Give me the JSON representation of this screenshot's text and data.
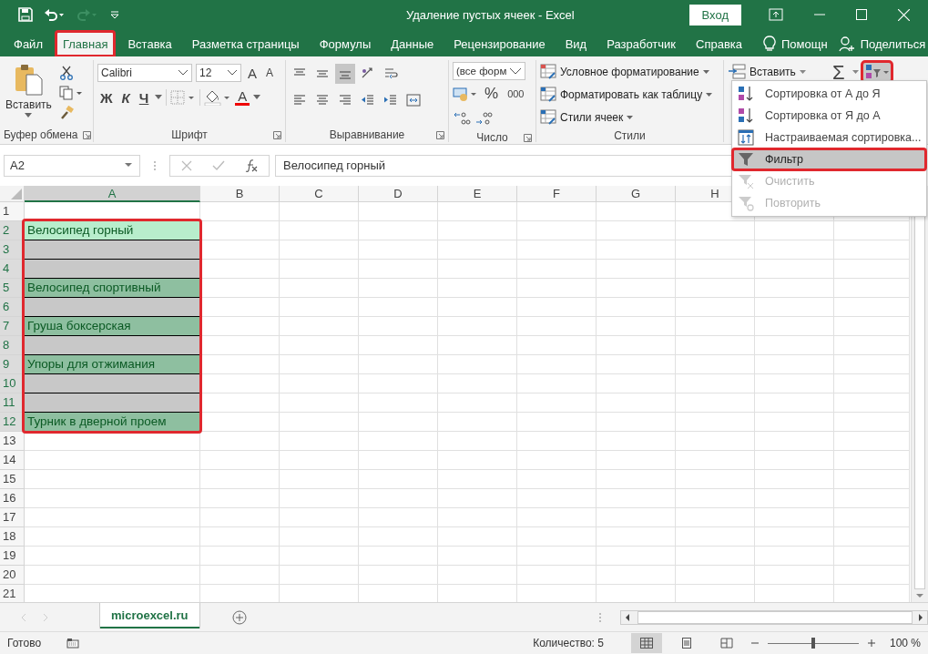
{
  "window": {
    "title": "Удаление пустых ячеек - Excel",
    "sign_in": "Вход"
  },
  "tabs": [
    {
      "label": "Файл",
      "selected": false
    },
    {
      "label": "Главная",
      "selected": true
    },
    {
      "label": "Вставка",
      "selected": false
    },
    {
      "label": "Разметка страницы",
      "selected": false
    },
    {
      "label": "Формулы",
      "selected": false
    },
    {
      "label": "Данные",
      "selected": false
    },
    {
      "label": "Рецензирование",
      "selected": false
    },
    {
      "label": "Вид",
      "selected": false
    },
    {
      "label": "Разработчик",
      "selected": false
    },
    {
      "label": "Справка",
      "selected": false
    }
  ],
  "tell_me": "Помощн",
  "share": "Поделиться",
  "ribbon": {
    "clipboard": {
      "paste": "Вставить",
      "label": "Буфер обмена"
    },
    "font": {
      "name": "Calibri",
      "size": "12",
      "grow": "A",
      "shrink": "A",
      "styles": [
        "Ж",
        "К",
        "Ч"
      ],
      "color_letter": "A",
      "label": "Шрифт"
    },
    "alignment": {
      "rows": [
        [
          {
            "kind": "top",
            "on": false
          },
          {
            "kind": "middle",
            "on": false
          },
          {
            "kind": "bottom",
            "on": true
          },
          {
            "kind": "orientation",
            "on": false
          },
          {
            "kind": "wrap",
            "on": false
          }
        ],
        [
          {
            "kind": "left",
            "on": false
          },
          {
            "kind": "center",
            "on": false
          },
          {
            "kind": "right",
            "on": false
          },
          {
            "kind": "outdent",
            "on": false
          },
          {
            "kind": "indent",
            "on": false
          },
          {
            "kind": "merge",
            "on": false
          }
        ]
      ],
      "label": "Выравнивание"
    },
    "number": {
      "format": "(все форм",
      "percent": "%",
      "thousands": "000",
      "label": "Число"
    },
    "styles": {
      "items": [
        "Условное форматирование",
        "Форматировать как таблицу",
        "Стили ячеек"
      ],
      "label": "Стили"
    },
    "cells": {
      "insert": "Вставить"
    },
    "editing": {
      "sum": "Σ",
      "sort_filter_highlighted": true
    }
  },
  "sort_menu": [
    {
      "kind": "sort_az",
      "label": "Сортировка от А до Я",
      "disabled": false,
      "selected": false
    },
    {
      "kind": "sort_za",
      "label": "Сортировка от Я до А",
      "disabled": false,
      "selected": false
    },
    {
      "kind": "custom",
      "label": "Настраиваемая сортировка...",
      "disabled": false,
      "selected": false
    },
    {
      "kind": "filter",
      "label": "Фильтр",
      "disabled": false,
      "selected": true
    },
    {
      "kind": "clear",
      "label": "Очистить",
      "disabled": true,
      "selected": false
    },
    {
      "kind": "reapply",
      "label": "Повторить",
      "disabled": true,
      "selected": false
    }
  ],
  "formula_bar": {
    "name_box": "A2",
    "formula": "Велосипед горный"
  },
  "columns": [
    {
      "label": "A",
      "selected": true
    },
    {
      "label": "B",
      "selected": false
    },
    {
      "label": "C",
      "selected": false
    },
    {
      "label": "D",
      "selected": false
    },
    {
      "label": "E",
      "selected": false
    },
    {
      "label": "F",
      "selected": false
    },
    {
      "label": "G",
      "selected": false
    },
    {
      "label": "H",
      "selected": false
    }
  ],
  "rows": [
    {
      "number": "1",
      "selected": false
    },
    {
      "number": "2",
      "selected": true,
      "active": true,
      "value": "Велосипед горный"
    },
    {
      "number": "3",
      "selected": true,
      "active": false
    },
    {
      "number": "4",
      "selected": true,
      "active": false
    },
    {
      "number": "5",
      "selected": true,
      "active": false,
      "value": "Велосипед спортивный"
    },
    {
      "number": "6",
      "selected": true,
      "active": false
    },
    {
      "number": "7",
      "selected": true,
      "active": false,
      "value": "Груша боксерская"
    },
    {
      "number": "8",
      "selected": true,
      "active": false
    },
    {
      "number": "9",
      "selected": true,
      "active": false,
      "value": "Упоры для отжимания"
    },
    {
      "number": "10",
      "selected": true,
      "active": false
    },
    {
      "number": "11",
      "selected": true,
      "active": false
    },
    {
      "number": "12",
      "selected": true,
      "active": false,
      "value": "Турник в дверной проем"
    },
    {
      "number": "13",
      "selected": false
    },
    {
      "number": "14",
      "selected": false
    },
    {
      "number": "15",
      "selected": false
    },
    {
      "number": "16",
      "selected": false
    },
    {
      "number": "17",
      "selected": false
    },
    {
      "number": "18",
      "selected": false
    },
    {
      "number": "19",
      "selected": false
    },
    {
      "number": "20",
      "selected": false
    },
    {
      "number": "21",
      "selected": false
    }
  ],
  "sheets": [
    {
      "label": "microexcel.ru",
      "selected": true
    }
  ],
  "status": {
    "ready": "Готово",
    "count": "Количество: 5",
    "views": [
      {
        "kind": "normal",
        "selected": true
      },
      {
        "kind": "layout",
        "selected": false
      },
      {
        "kind": "pagebreak",
        "selected": false
      }
    ],
    "zoom": {
      "level": 0.5,
      "reading": "100 %"
    }
  }
}
